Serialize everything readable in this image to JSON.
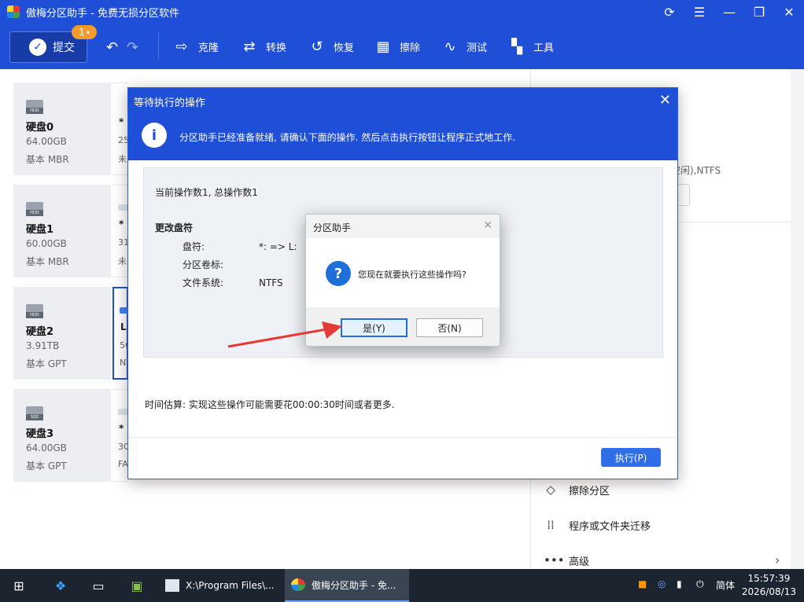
{
  "window": {
    "title": "傲梅分区助手 - 免费无损分区软件"
  },
  "toolbar": {
    "submit_label": "提交",
    "submit_badge": "1",
    "items": [
      "克隆",
      "转换",
      "恢复",
      "擦除",
      "测试",
      "工具"
    ]
  },
  "disks": [
    {
      "name": "硬盘0",
      "size": "64.00GB",
      "type": "基本 MBR",
      "icon_label": "HDD",
      "part_mark": "*",
      "part_l2": "25",
      "part_l3": "未"
    },
    {
      "name": "硬盘1",
      "size": "60.00GB",
      "type": "基本 MBR",
      "icon_label": "HDD",
      "part_mark": "*",
      "part_l2": "31",
      "part_l3": "未"
    },
    {
      "name": "硬盘2",
      "size": "3.91TB",
      "type": "基本 GPT",
      "icon_label": "HDD",
      "part_mark": "L",
      "part_l2": "50",
      "part_l3": "NT"
    },
    {
      "name": "硬盘3",
      "size": "64.00GB",
      "type": "基本 GPT",
      "icon_label": "SSD",
      "part_mark": "*",
      "part_l2": "30",
      "part_l3": "FA"
    }
  ],
  "right_panel": {
    "fs_text": "空闲),NTFS",
    "ops": [
      "擦除分区",
      "程序或文件夹迁移",
      "高级"
    ]
  },
  "pending_dialog": {
    "title": "等待执行的操作",
    "message": "分区助手已经准备就绪, 请确认下面的操作. 然后点击执行按钮让程序正式地工作.",
    "count_text": "当前操作数1, 总操作数1",
    "op_title": "更改盘符",
    "rows": [
      {
        "label": "盘符:",
        "value": "*: => L:"
      },
      {
        "label": "分区卷标:",
        "value": ""
      },
      {
        "label": "文件系统:",
        "value": "NTFS"
      }
    ],
    "estimate": "时间估算: 实现这些操作可能需要花00:00:30时间或者更多.",
    "execute_label": "执行(P)"
  },
  "confirm_dialog": {
    "title": "分区助手",
    "message": "您现在就要执行这些操作吗?",
    "yes_label": "是(Y)",
    "no_label": "否(N)"
  },
  "taskbar": {
    "tasks": [
      "X:\\Program Files\\...",
      "傲梅分区助手 - 免..."
    ],
    "ime": "简体",
    "time": "15:57:39",
    "date": "2026/08/13"
  },
  "colors": {
    "brand_blue": "#1f4fd6",
    "badge_orange": "#f39c2b",
    "arrow_red": "#e53935"
  }
}
